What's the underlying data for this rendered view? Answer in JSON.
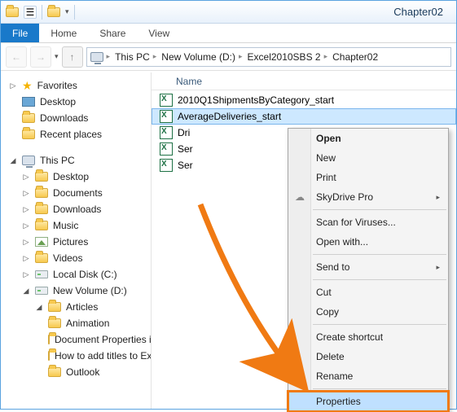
{
  "window": {
    "title": "Chapter02"
  },
  "menu": {
    "file": "File",
    "home": "Home",
    "share": "Share",
    "view": "View"
  },
  "breadcrumb": [
    "This PC",
    "New Volume (D:)",
    "Excel2010SBS 2",
    "Chapter02"
  ],
  "favorites": {
    "header": "Favorites",
    "items": [
      "Desktop",
      "Downloads",
      "Recent places"
    ]
  },
  "thispc": {
    "header": "This PC",
    "items": [
      "Desktop",
      "Documents",
      "Downloads",
      "Music",
      "Pictures",
      "Videos",
      "Local Disk (C:)",
      "New Volume (D:)"
    ],
    "subfolder": {
      "name": "Articles",
      "children": [
        "Animation",
        "Document Properties in Excel",
        "How to add titles to Excel charts",
        "Outlook"
      ]
    }
  },
  "columns": {
    "name": "Name"
  },
  "files": [
    {
      "name": "2010Q1ShipmentsByCategory_start"
    },
    {
      "name": "AverageDeliveries_start"
    },
    {
      "name": "Dri"
    },
    {
      "name": "Ser"
    },
    {
      "name": "Ser"
    }
  ],
  "context": {
    "open": "Open",
    "new": "New",
    "print": "Print",
    "skydrive": "SkyDrive Pro",
    "scan": "Scan for Viruses...",
    "openwith": "Open with...",
    "sendto": "Send to",
    "cut": "Cut",
    "copy": "Copy",
    "shortcut": "Create shortcut",
    "delete": "Delete",
    "rename": "Rename",
    "properties": "Properties"
  },
  "arrow_color": "#f07a13"
}
